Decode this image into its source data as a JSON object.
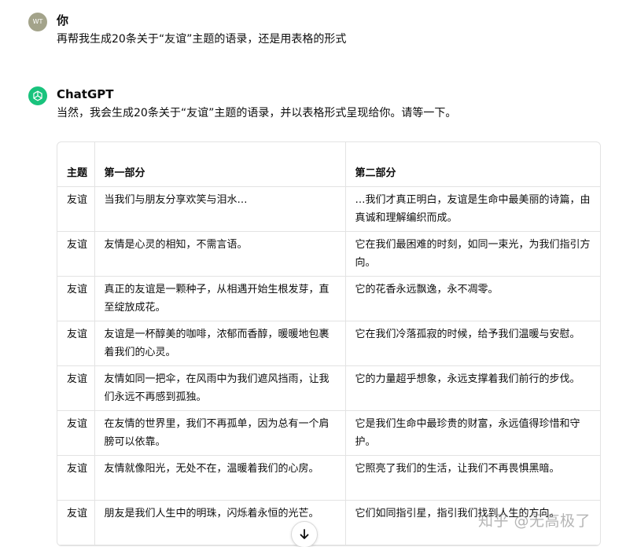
{
  "user_message": {
    "avatar_initials": "WT",
    "author": "你",
    "text": "再帮我生成20条关于“友谊”主题的语录，还是用表格的形式"
  },
  "assistant_message": {
    "author": "ChatGPT",
    "text": "当然，我会生成20条关于“友谊”主题的语录，并以表格形式呈现给你。请等一下。",
    "avatar_icon": "openai-logo-icon",
    "avatar_color": "#19c37d"
  },
  "table": {
    "headers": [
      "主题",
      "第一部分",
      "第二部分"
    ],
    "rows": [
      [
        "友谊",
        "当我们与朋友分享欢笑与泪水…",
        "…我们才真正明白，友谊是生命中最美丽的诗篇，由真诚和理解编织而成。"
      ],
      [
        "友谊",
        "友情是心灵的相知，不需言语。",
        "它在我们最困难的时刻，如同一束光，为我们指引方向。"
      ],
      [
        "友谊",
        "真正的友谊是一颗种子，从相遇开始生根发芽，直至绽放成花。",
        "它的花香永远飘逸，永不凋零。"
      ],
      [
        "友谊",
        "友谊是一杯醇美的咖啡，浓郁而香醇，暖暖地包裹着我们的心灵。",
        "它在我们冷落孤寂的时候，给予我们温暖与安慰。"
      ],
      [
        "友谊",
        "友情如同一把伞，在风雨中为我们遮风挡雨，让我们永远不再感到孤独。",
        "它的力量超乎想象，永远支撑着我们前行的步伐。"
      ],
      [
        "友谊",
        "在友情的世界里，我们不再孤单，因为总有一个肩膀可以依靠。",
        "它是我们生命中最珍贵的财富，永远值得珍惜和守护。"
      ],
      [
        "友谊",
        "友情就像阳光，无处不在，温暖着我们的心房。",
        "它照亮了我们的生活，让我们不再畏惧黑暗。"
      ],
      [
        "友谊",
        "朋友是我们人生中的明珠，闪烁着永恒的光芒。",
        "它们如同指引星，指引我们找到人生的方向。"
      ]
    ]
  },
  "scroll_button": {
    "icon": "arrow-down-icon"
  },
  "watermark": "知乎 @无高极了"
}
